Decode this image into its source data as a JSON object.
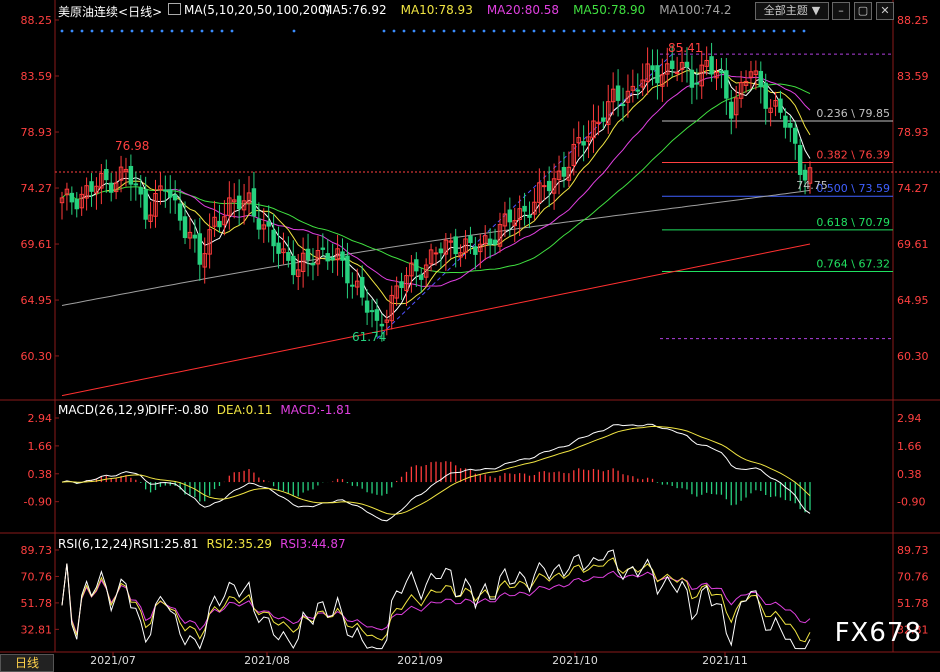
{
  "header": {
    "symbol": "美原油连续",
    "period": "日线",
    "ma_title": "MA(5,10,20,50,100,200)",
    "ma_values": [
      {
        "label": "MA5:76.92",
        "color": "#ffffff"
      },
      {
        "label": "MA10:78.93",
        "color": "#f0e442"
      },
      {
        "label": "MA20:80.58",
        "color": "#e040e0"
      },
      {
        "label": "MA50:78.90",
        "color": "#40e040"
      },
      {
        "label": "MA100:74.2",
        "color": "#a0a0a0"
      }
    ],
    "theme_button": "全部主题",
    "theme_arrow": "▼"
  },
  "colors": {
    "up": "#ff3b3b",
    "down": "#27d17f",
    "axis": "#ff4040",
    "grid": "#8a1a1a",
    "fib": "#b0b0b0"
  },
  "chart_data": {
    "type": "candlestick",
    "x_labels": [
      "2021/07",
      "2021/08",
      "2021/09",
      "2021/10",
      "2021/11"
    ],
    "price_panel": {
      "y_ticks": [
        88.25,
        83.59,
        78.93,
        74.27,
        69.61,
        64.95,
        60.3
      ],
      "ylim": [
        56.8,
        88.25
      ],
      "high_label": "85.41",
      "low_label": "61.74",
      "left_high_label": "76.98",
      "current_price_line": 75.6,
      "fib_levels": [
        {
          "label": "0.236 \\ 79.85",
          "value": 79.85
        },
        {
          "label": "0.382 \\ 76.39",
          "value": 76.39
        },
        {
          "label": "0.500 \\ 73.59",
          "value": 73.59
        },
        {
          "label": "0.618 \\ 70.79",
          "value": 70.79
        },
        {
          "label": "0.764 \\ 67.32",
          "value": 67.32
        }
      ],
      "fib_bounds": [
        85.41,
        61.74
      ],
      "last_price_label": "74.75"
    },
    "macd_panel": {
      "title": "MACD(26,12,9)",
      "values": [
        {
          "label": "DIFF:-0.80",
          "color": "#ffffff"
        },
        {
          "label": "DEA:0.11",
          "color": "#f0e442"
        },
        {
          "label": "MACD:-1.81",
          "color": "#e040e0"
        }
      ],
      "y_ticks": [
        2.94,
        1.66,
        0.38,
        -0.9
      ],
      "ylim": [
        -2.2,
        2.94
      ]
    },
    "rsi_panel": {
      "title": "RSI(6,12,24)",
      "values": [
        {
          "label": "RSI1:25.81",
          "color": "#ffffff"
        },
        {
          "label": "RSI2:35.29",
          "color": "#f0e442"
        },
        {
          "label": "RSI3:44.87",
          "color": "#e040e0"
        }
      ],
      "y_ticks": [
        89.73,
        70.76,
        51.78,
        32.81
      ],
      "ylim": [
        18,
        89.73
      ]
    },
    "bottom_tab": "日线",
    "watermark": "FX678"
  }
}
